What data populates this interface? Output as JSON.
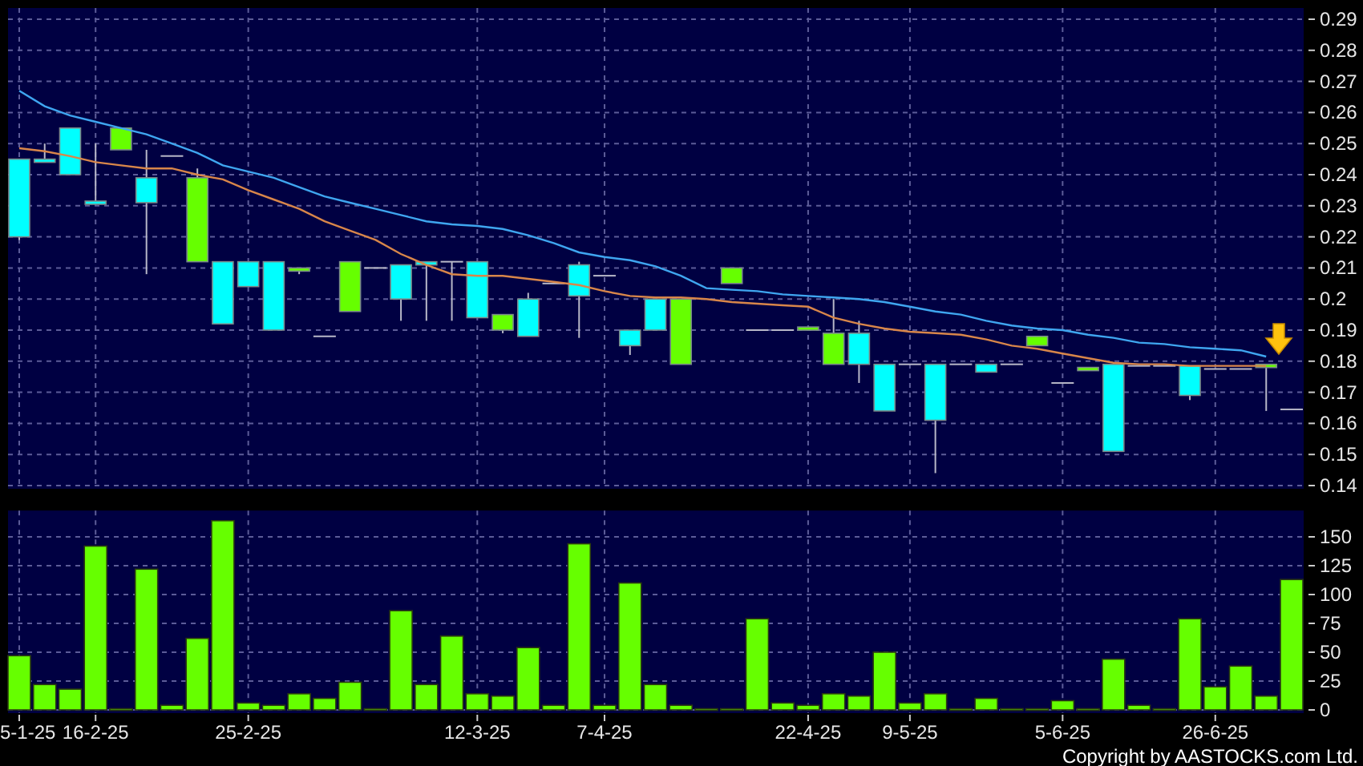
{
  "price_chart": {
    "chart_data": {
      "type": "line",
      "grid": true,
      "ylim": [
        0.14,
        0.29
      ],
      "yticks": [
        0.29,
        0.28,
        0.27,
        0.26,
        0.25,
        0.24,
        0.23,
        0.22,
        0.21,
        0.2,
        0.19,
        0.18,
        0.17,
        0.16,
        0.15,
        0.14
      ],
      "series": [
        {
          "color": "#3fa6f0",
          "values": [
            0.267,
            0.262,
            0.259,
            0.257,
            0.255,
            0.253,
            0.25,
            0.247,
            0.243,
            0.241,
            0.239,
            0.236,
            0.233,
            0.231,
            0.229,
            0.227,
            0.225,
            0.224,
            0.2235,
            0.2225,
            0.2205,
            0.218,
            0.215,
            0.2135,
            0.2125,
            0.2105,
            0.2075,
            0.2035,
            0.203,
            0.2025,
            0.2015,
            0.201,
            0.2005,
            0.2,
            0.199,
            0.1975,
            0.196,
            0.195,
            0.193,
            0.1915,
            0.1905,
            0.19,
            0.1885,
            0.1875,
            0.186,
            0.1855,
            0.1845,
            0.184,
            0.1835,
            0.1815,
            null
          ]
        },
        {
          "color": "#d8864a",
          "values": [
            0.2485,
            0.2475,
            0.246,
            0.244,
            0.243,
            0.242,
            0.242,
            0.24,
            0.2385,
            0.235,
            0.232,
            0.229,
            0.225,
            0.222,
            0.219,
            0.2145,
            0.211,
            0.208,
            0.2075,
            0.2075,
            0.2065,
            0.2055,
            0.2045,
            0.2025,
            0.201,
            0.2005,
            0.2005,
            0.2,
            0.199,
            0.1985,
            0.198,
            0.1975,
            0.194,
            0.192,
            0.1905,
            0.1895,
            0.189,
            0.1885,
            0.187,
            0.185,
            0.184,
            0.1825,
            0.181,
            0.1795,
            0.179,
            0.179,
            0.1785,
            0.1785,
            0.1785,
            0.1785,
            null
          ]
        }
      ]
    }
  },
  "volume_chart": {
    "chart_data": {
      "type": "bar",
      "grid": true,
      "ylim": [
        0,
        170
      ],
      "yticks": [
        150,
        125,
        100,
        75,
        50,
        25,
        0
      ],
      "categories": [
        "5-1-25",
        null,
        null,
        "16-2-25",
        null,
        null,
        null,
        null,
        null,
        "25-2-25",
        null,
        null,
        null,
        null,
        null,
        null,
        null,
        null,
        "12-3-25",
        null,
        null,
        null,
        null,
        "7-4-25",
        null,
        null,
        null,
        null,
        null,
        null,
        null,
        "22-4-25",
        null,
        null,
        null,
        "9-5-25",
        null,
        null,
        null,
        null,
        null,
        "5-6-25",
        null,
        null,
        null,
        null,
        null,
        "26-6-25",
        null,
        null,
        null
      ],
      "values": [
        47,
        22,
        18,
        142,
        1,
        122,
        4,
        62,
        164,
        6,
        4,
        14,
        10,
        24,
        1,
        86,
        22,
        64,
        14,
        12,
        54,
        4,
        144,
        4,
        110,
        22,
        4,
        1,
        1,
        79,
        6,
        4,
        14,
        12,
        50,
        6,
        14,
        1,
        10,
        1,
        1,
        8,
        1,
        44,
        4,
        1,
        79,
        20,
        38,
        12,
        113
      ]
    }
  },
  "copyright": "Copyright by AASTOCKS.com Ltd."
}
